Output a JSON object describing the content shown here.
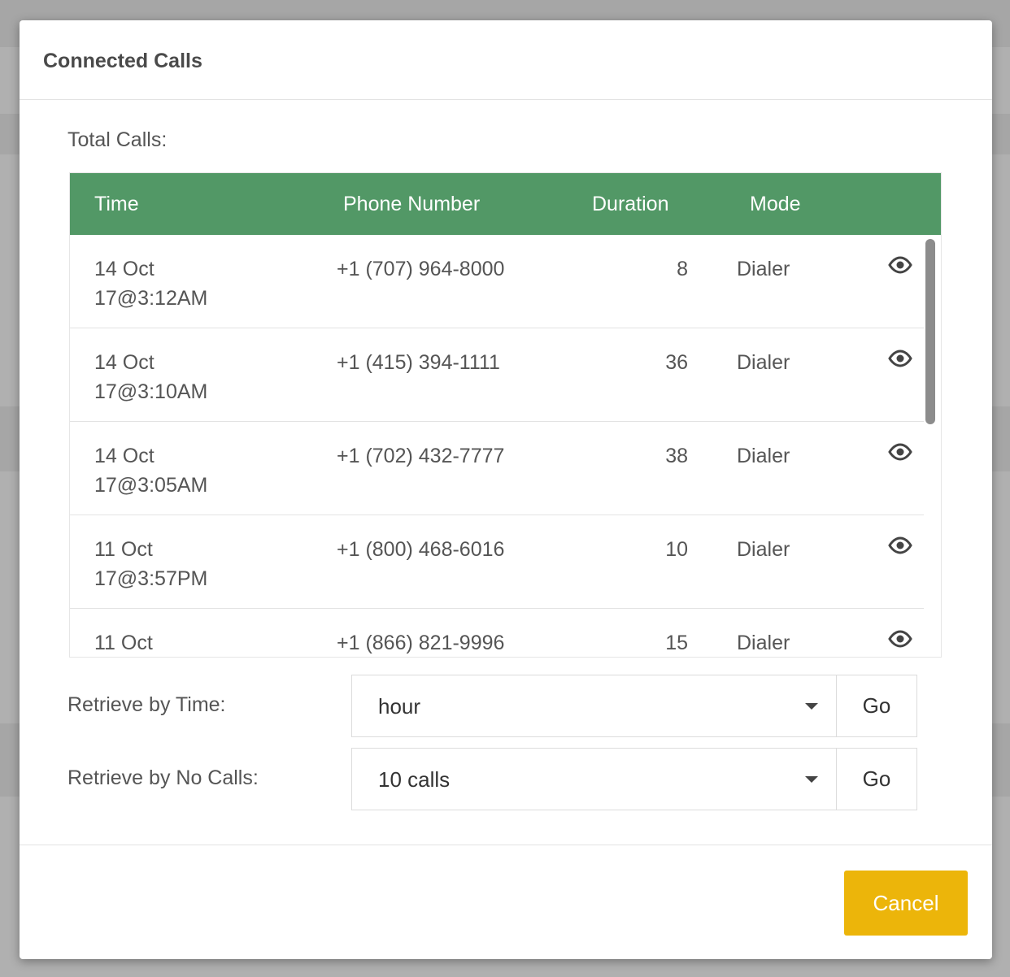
{
  "modal": {
    "title": "Connected Calls",
    "total_calls_label": "Total Calls:"
  },
  "table": {
    "headers": [
      "Time",
      "Phone Number",
      "Duration",
      "Mode"
    ],
    "rows": [
      {
        "time_line1": "14 Oct",
        "time_line2": "17@3:12AM",
        "phone": "+1 (707) 964-8000",
        "duration": "8",
        "mode": "Dialer"
      },
      {
        "time_line1": "14 Oct",
        "time_line2": "17@3:10AM",
        "phone": "+1 (415) 394-1111",
        "duration": "36",
        "mode": "Dialer"
      },
      {
        "time_line1": "14 Oct",
        "time_line2": "17@3:05AM",
        "phone": "+1 (702) 432-7777",
        "duration": "38",
        "mode": "Dialer"
      },
      {
        "time_line1": "11 Oct",
        "time_line2": "17@3:57PM",
        "phone": "+1 (800) 468-6016",
        "duration": "10",
        "mode": "Dialer"
      },
      {
        "time_line1": "11 Oct",
        "time_line2": "",
        "phone": "+1 (866) 821-9996",
        "duration": "15",
        "mode": "Dialer"
      }
    ],
    "header_color": "#529866",
    "row_action_icon": "eye-icon"
  },
  "retrieve_time": {
    "label": "Retrieve by Time:",
    "selected": "hour",
    "go_label": "Go"
  },
  "retrieve_calls": {
    "label": "Retrieve by No Calls:",
    "selected": "10 calls",
    "go_label": "Go"
  },
  "footer": {
    "cancel_label": "Cancel",
    "cancel_color": "#ecb50a"
  }
}
